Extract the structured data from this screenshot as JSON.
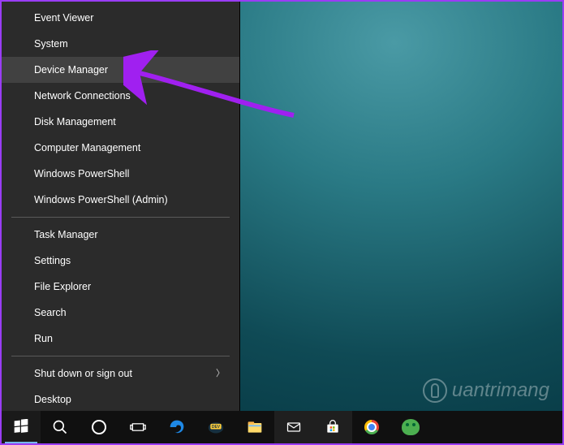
{
  "menu": {
    "group1": [
      "Event Viewer",
      "System",
      "Device Manager",
      "Network Connections",
      "Disk Management",
      "Computer Management",
      "Windows PowerShell",
      "Windows PowerShell (Admin)"
    ],
    "group2": [
      "Task Manager",
      "Settings",
      "File Explorer",
      "Search",
      "Run"
    ],
    "group3": [
      {
        "label": "Shut down or sign out",
        "submenu": true
      },
      {
        "label": "Desktop",
        "submenu": false
      }
    ],
    "highlighted_index": 2
  },
  "watermark": {
    "text": "uantrimang"
  },
  "taskbar": {
    "items": [
      {
        "name": "start-button",
        "icon": "windows-icon",
        "active": true
      },
      {
        "name": "search-button",
        "icon": "search-icon",
        "active": false
      },
      {
        "name": "cortana-button",
        "icon": "cortana-icon",
        "active": false
      },
      {
        "name": "taskview-button",
        "icon": "taskview-icon",
        "active": false
      },
      {
        "name": "edge-app",
        "icon": "edge-icon",
        "active": false
      },
      {
        "name": "dev-app",
        "icon": "dev-icon",
        "active": false
      },
      {
        "name": "explorer-app",
        "icon": "explorer-icon",
        "active": false
      },
      {
        "name": "mail-app",
        "icon": "mail-icon",
        "active": false
      },
      {
        "name": "store-app",
        "icon": "store-icon",
        "active": false
      },
      {
        "name": "chrome-app",
        "icon": "chrome-icon",
        "active": false
      },
      {
        "name": "basecamp-app",
        "icon": "basecamp-icon",
        "active": false
      }
    ]
  }
}
